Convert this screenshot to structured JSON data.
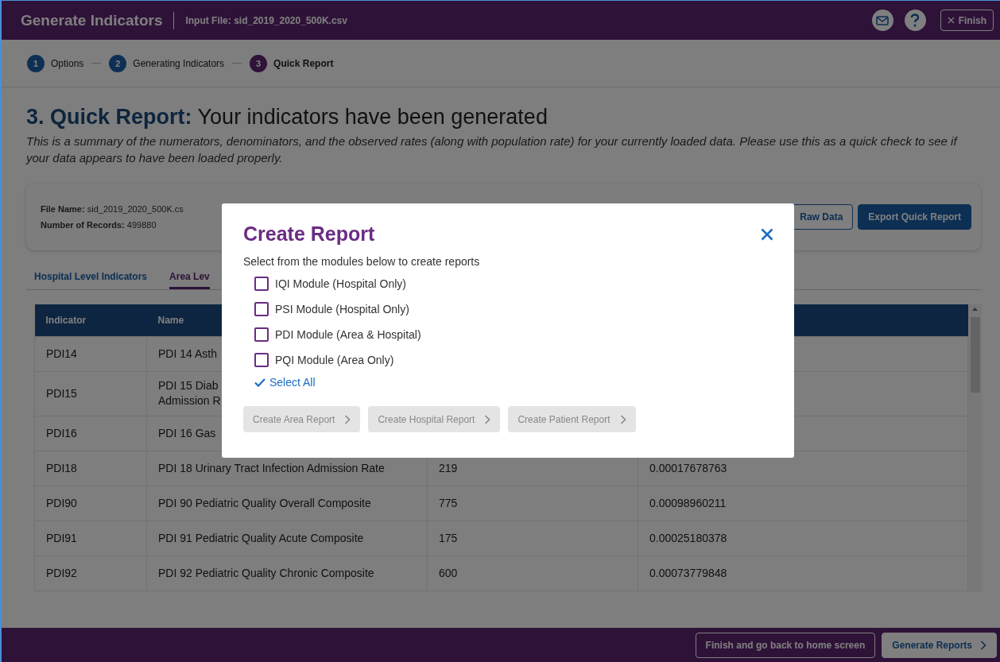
{
  "header": {
    "title": "Generate Indicators",
    "input_file_label": "Input File:",
    "input_file": "sid_2019_2020_500K.csv",
    "finish_button": "Finish"
  },
  "stepper": [
    {
      "number": "1",
      "label": "Options",
      "selected": false
    },
    {
      "number": "2",
      "label": "Generating Indicators",
      "selected": false
    },
    {
      "number": "3",
      "label": "Quick Report",
      "selected": true
    }
  ],
  "page": {
    "title_bold": "3. Quick Report:",
    "title_rest": "Your indicators have been generated",
    "description": "This is a summary of the numerators, denominators, and the observed rates (along with population rate) for your currently loaded data. Please use this as a quick check to see if your data appears to have been loaded properly."
  },
  "summary": {
    "fields": [
      {
        "label": "File Name:",
        "value": "sid_2019_2020_500K.cs"
      },
      {
        "label": "Number of Records:",
        "value": "499880"
      }
    ],
    "buttons": [
      {
        "label": "Raw Data",
        "kind": "outline"
      },
      {
        "label": "Export Quick Report",
        "kind": "primary"
      }
    ]
  },
  "tabs": [
    {
      "label": "Hospital Level Indicators",
      "selected": false
    },
    {
      "label": "Area Lev",
      "selected": true
    }
  ],
  "table": {
    "columns": [
      "Indicator",
      "Name"
    ],
    "rows": [
      {
        "cells": [
          "PDI14",
          "PDI 14 Asth"
        ]
      },
      {
        "cells": [
          "PDI15",
          "PDI 15 Diab Admission R"
        ]
      },
      {
        "cells": [
          "PDI16",
          "PDI 16 Gas"
        ]
      },
      {
        "cells": [
          "PDI18",
          "PDI 18 Urinary Tract Infection Admission Rate",
          "219",
          "0.00017678763"
        ]
      },
      {
        "cells": [
          "PDI90",
          "PDI 90 Pediatric Quality Overall Composite",
          "775",
          "0.00098960211"
        ]
      },
      {
        "cells": [
          "PDI91",
          "PDI 91 Pediatric Quality Acute Composite",
          "175",
          "0.00025180378"
        ]
      },
      {
        "cells": [
          "PDI92",
          "PDI 92 Pediatric Quality Chronic Composite",
          "600",
          "0.00073779848"
        ]
      }
    ]
  },
  "dialog": {
    "title": "Create Report",
    "subtitle": "Select from the modules below to create reports",
    "modules": [
      {
        "label": "IQI Module (Hospital Only)",
        "checked": false
      },
      {
        "label": "PSI Module (Hospital Only)",
        "checked": false
      },
      {
        "label": "PDI Module (Area & Hospital)",
        "checked": false
      },
      {
        "label": "PQI Module (Area Only)",
        "checked": false
      }
    ],
    "select_all": "Select All",
    "buttons": [
      {
        "label": "Create Area Report",
        "disabled": true
      },
      {
        "label": "Create Hospital Report",
        "disabled": true
      },
      {
        "label": "Create Patient Report",
        "disabled": true
      }
    ]
  },
  "footer": {
    "buttons": [
      {
        "label": "Finish and go back to home screen",
        "kind": "outline"
      },
      {
        "label": "Generate Reports",
        "kind": "primary"
      }
    ]
  }
}
